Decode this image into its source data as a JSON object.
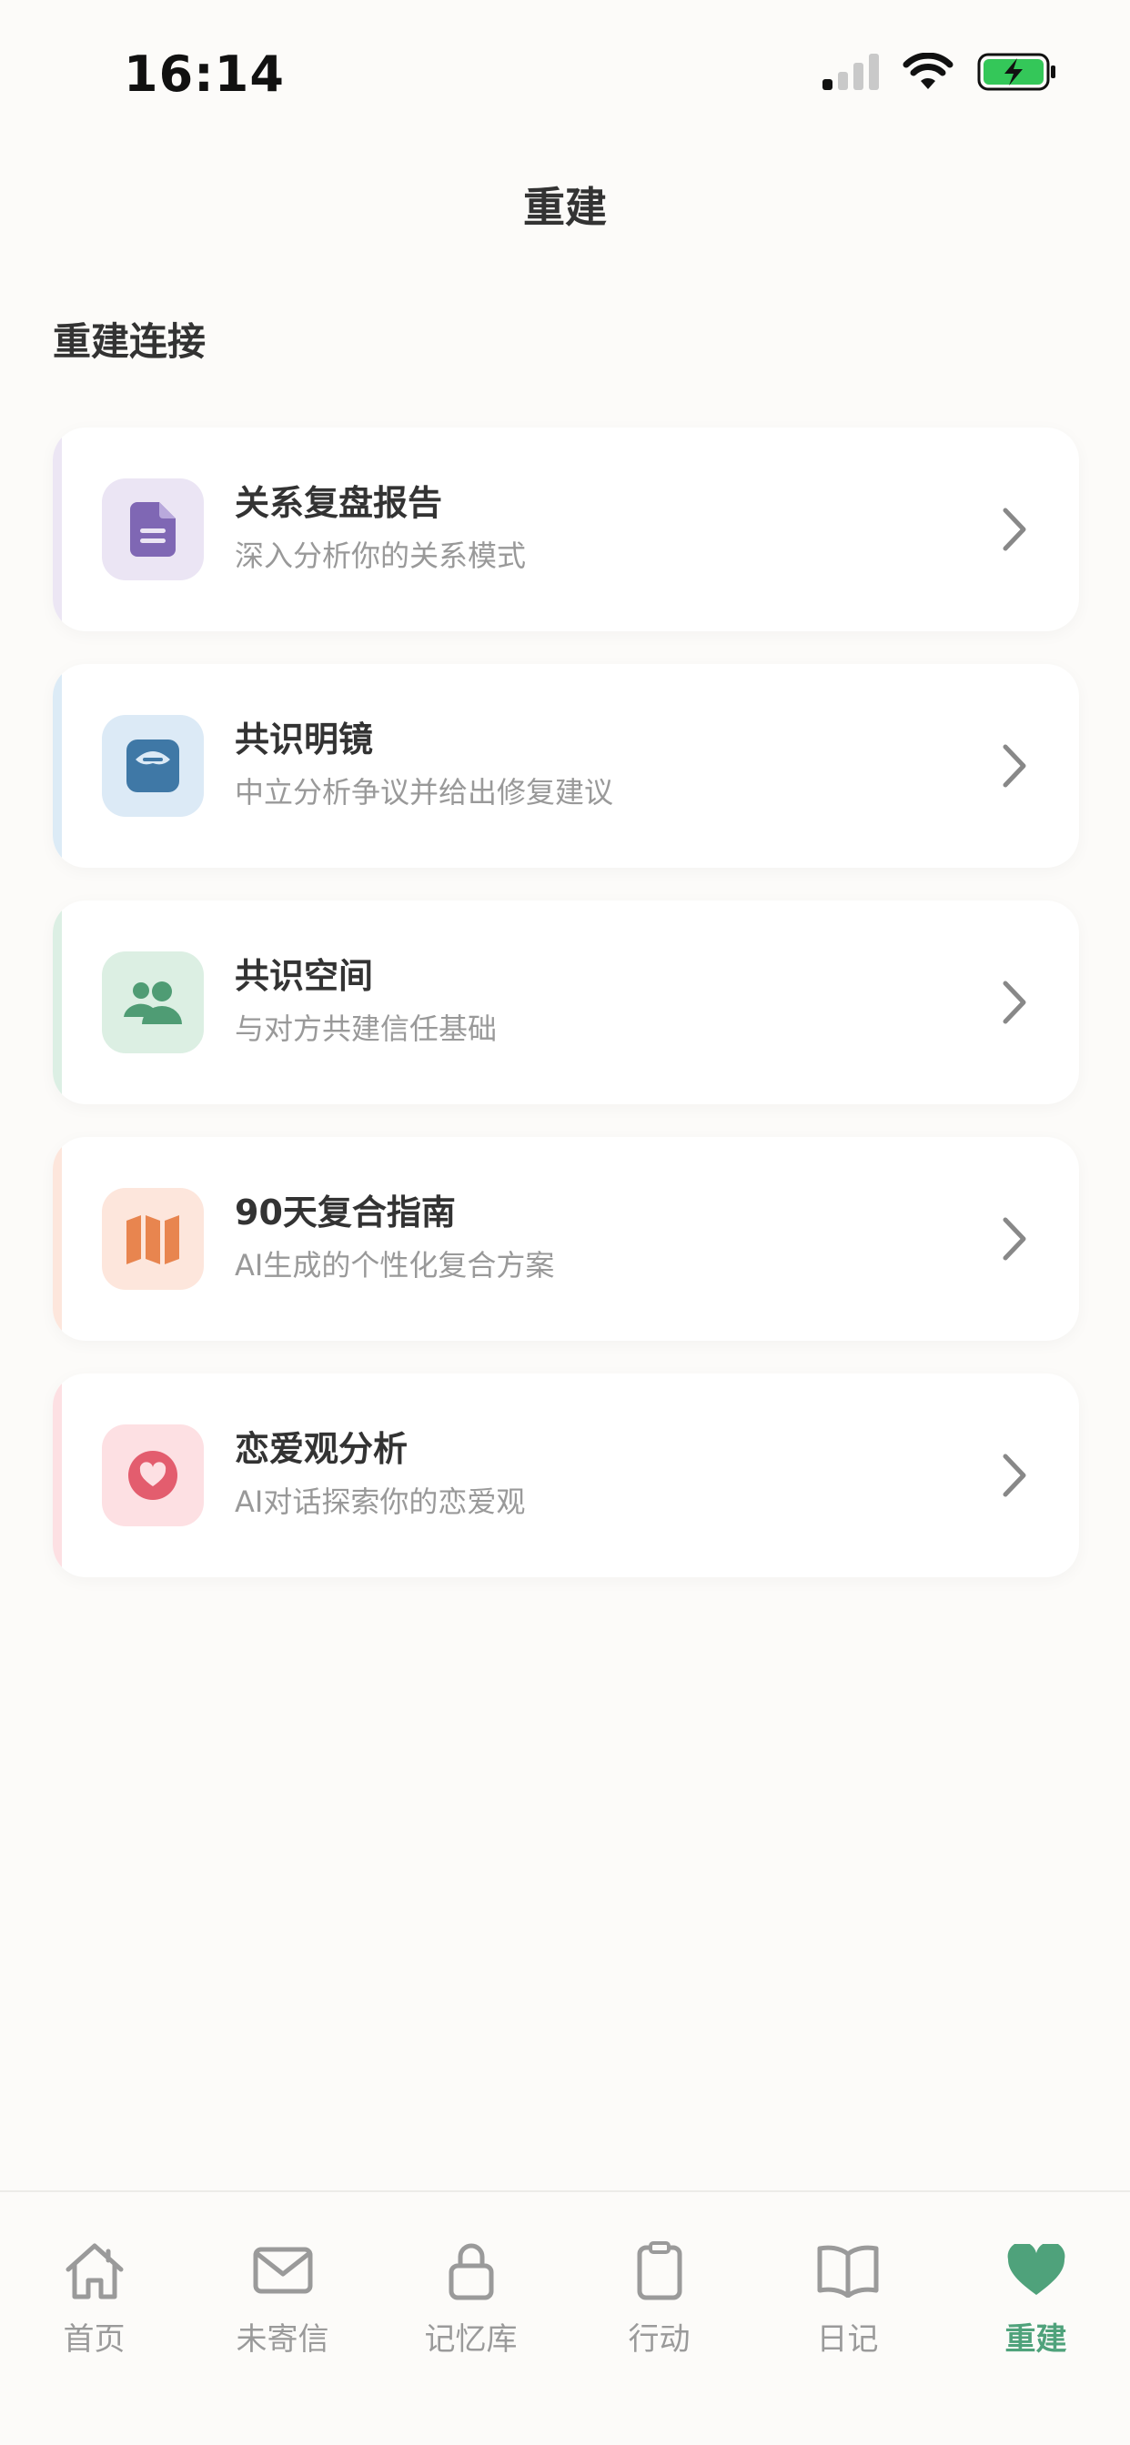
{
  "status_bar": {
    "time": "16:14"
  },
  "header": {
    "title": "重建"
  },
  "section": {
    "title": "重建连接"
  },
  "cards": [
    {
      "title": "关系复盘报告",
      "subtitle": "深入分析你的关系模式",
      "icon": "document-icon",
      "accent": "#ece6f4",
      "icon_bg": "#ebe5f4",
      "icon_color": "#7f67b4"
    },
    {
      "title": "共识明镜",
      "subtitle": "中立分析争议并给出修复建议",
      "icon": "mirror-icon",
      "accent": "#dcebf6",
      "icon_bg": "#dceaf6",
      "icon_color": "#3f78a6"
    },
    {
      "title": "共识空间",
      "subtitle": "与对方共建信任基础",
      "icon": "people-icon",
      "accent": "#dcefe4",
      "icon_bg": "#dcefe3",
      "icon_color": "#4f9c74"
    },
    {
      "title": "90天复合指南",
      "subtitle": "AI生成的个性化复合方案",
      "icon": "map-icon",
      "accent": "#fde6dc",
      "icon_bg": "#fde6dc",
      "icon_color": "#e8854f"
    },
    {
      "title": "恋爱观分析",
      "subtitle": "AI对话探索你的恋爱观",
      "icon": "heart-circle-icon",
      "accent": "#fde0e3",
      "icon_bg": "#fde0e3",
      "icon_color": "#e35d6e"
    }
  ],
  "tabs": [
    {
      "label": "首页",
      "icon": "home-icon",
      "active": false
    },
    {
      "label": "未寄信",
      "icon": "envelope-icon",
      "active": false
    },
    {
      "label": "记忆库",
      "icon": "lock-icon",
      "active": false
    },
    {
      "label": "行动",
      "icon": "clipboard-icon",
      "active": false
    },
    {
      "label": "日记",
      "icon": "book-icon",
      "active": false
    },
    {
      "label": "重建",
      "icon": "heart-icon",
      "active": true
    }
  ],
  "colors": {
    "accent_green": "#4fa27b",
    "inactive_gray": "#9a9a9a",
    "background": "#fcfbf9"
  }
}
